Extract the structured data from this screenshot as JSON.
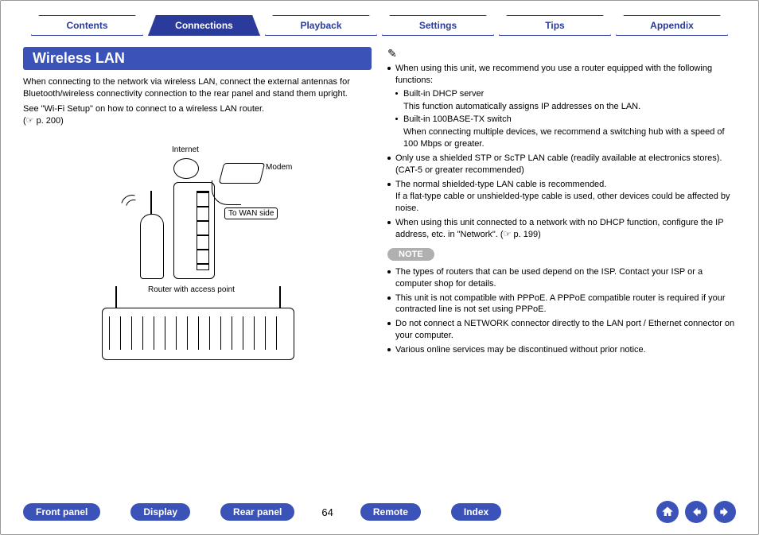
{
  "tabs": {
    "items": [
      {
        "label": "Contents",
        "active": false
      },
      {
        "label": "Connections",
        "active": true
      },
      {
        "label": "Playback",
        "active": false
      },
      {
        "label": "Settings",
        "active": false
      },
      {
        "label": "Tips",
        "active": false
      },
      {
        "label": "Appendix",
        "active": false
      }
    ]
  },
  "heading": "Wireless LAN",
  "left": {
    "p1": "When connecting to the network via wireless LAN, connect the external antennas for Bluetooth/wireless connectivity connection to the rear panel and stand them upright.",
    "p2": "See \"Wi-Fi Setup\" on how to connect to a wireless LAN router.",
    "ref": "(☞ p. 200)",
    "diagram": {
      "internet": "Internet",
      "modem": "Modem",
      "to_wan": "To WAN side",
      "router_ap": "Router with access point"
    }
  },
  "right": {
    "pencil_icon": "✎",
    "items": [
      {
        "text": "When using this unit, we recommend you use a router equipped with the following functions:",
        "sub": [
          {
            "title": "Built-in DHCP server",
            "desc": "This function automatically assigns IP addresses on the LAN."
          },
          {
            "title": "Built-in 100BASE-TX switch",
            "desc": "When connecting multiple devices, we recommend a switching hub with a speed of 100 Mbps or greater."
          }
        ]
      },
      {
        "text": "Only use a shielded STP or ScTP LAN cable (readily available at electronics stores). (CAT-5 or greater recommended)"
      },
      {
        "text": "The normal shielded-type LAN cable is recommended.",
        "desc": "If a flat-type cable or unshielded-type cable is used, other devices could be affected by noise."
      },
      {
        "text": "When using this unit connected to a network with no DHCP function, configure the IP address, etc. in \"Network\".  (☞ p. 199)"
      }
    ],
    "note_label": "NOTE",
    "notes": [
      "The types of routers that can be used depend on the ISP. Contact your ISP or a computer shop for details.",
      "This unit is not compatible with PPPoE. A PPPoE compatible router is required if your contracted line is not set using PPPoE.",
      "Do not connect a NETWORK connector directly to the LAN port / Ethernet connector on your computer.",
      "Various online services may be discontinued without prior notice."
    ]
  },
  "bottom": {
    "pills": [
      "Front panel",
      "Display",
      "Rear panel"
    ],
    "page": "64",
    "pills2": [
      "Remote",
      "Index"
    ],
    "nav": {
      "home": "home-icon",
      "back": "back-icon",
      "forward": "forward-icon"
    }
  }
}
